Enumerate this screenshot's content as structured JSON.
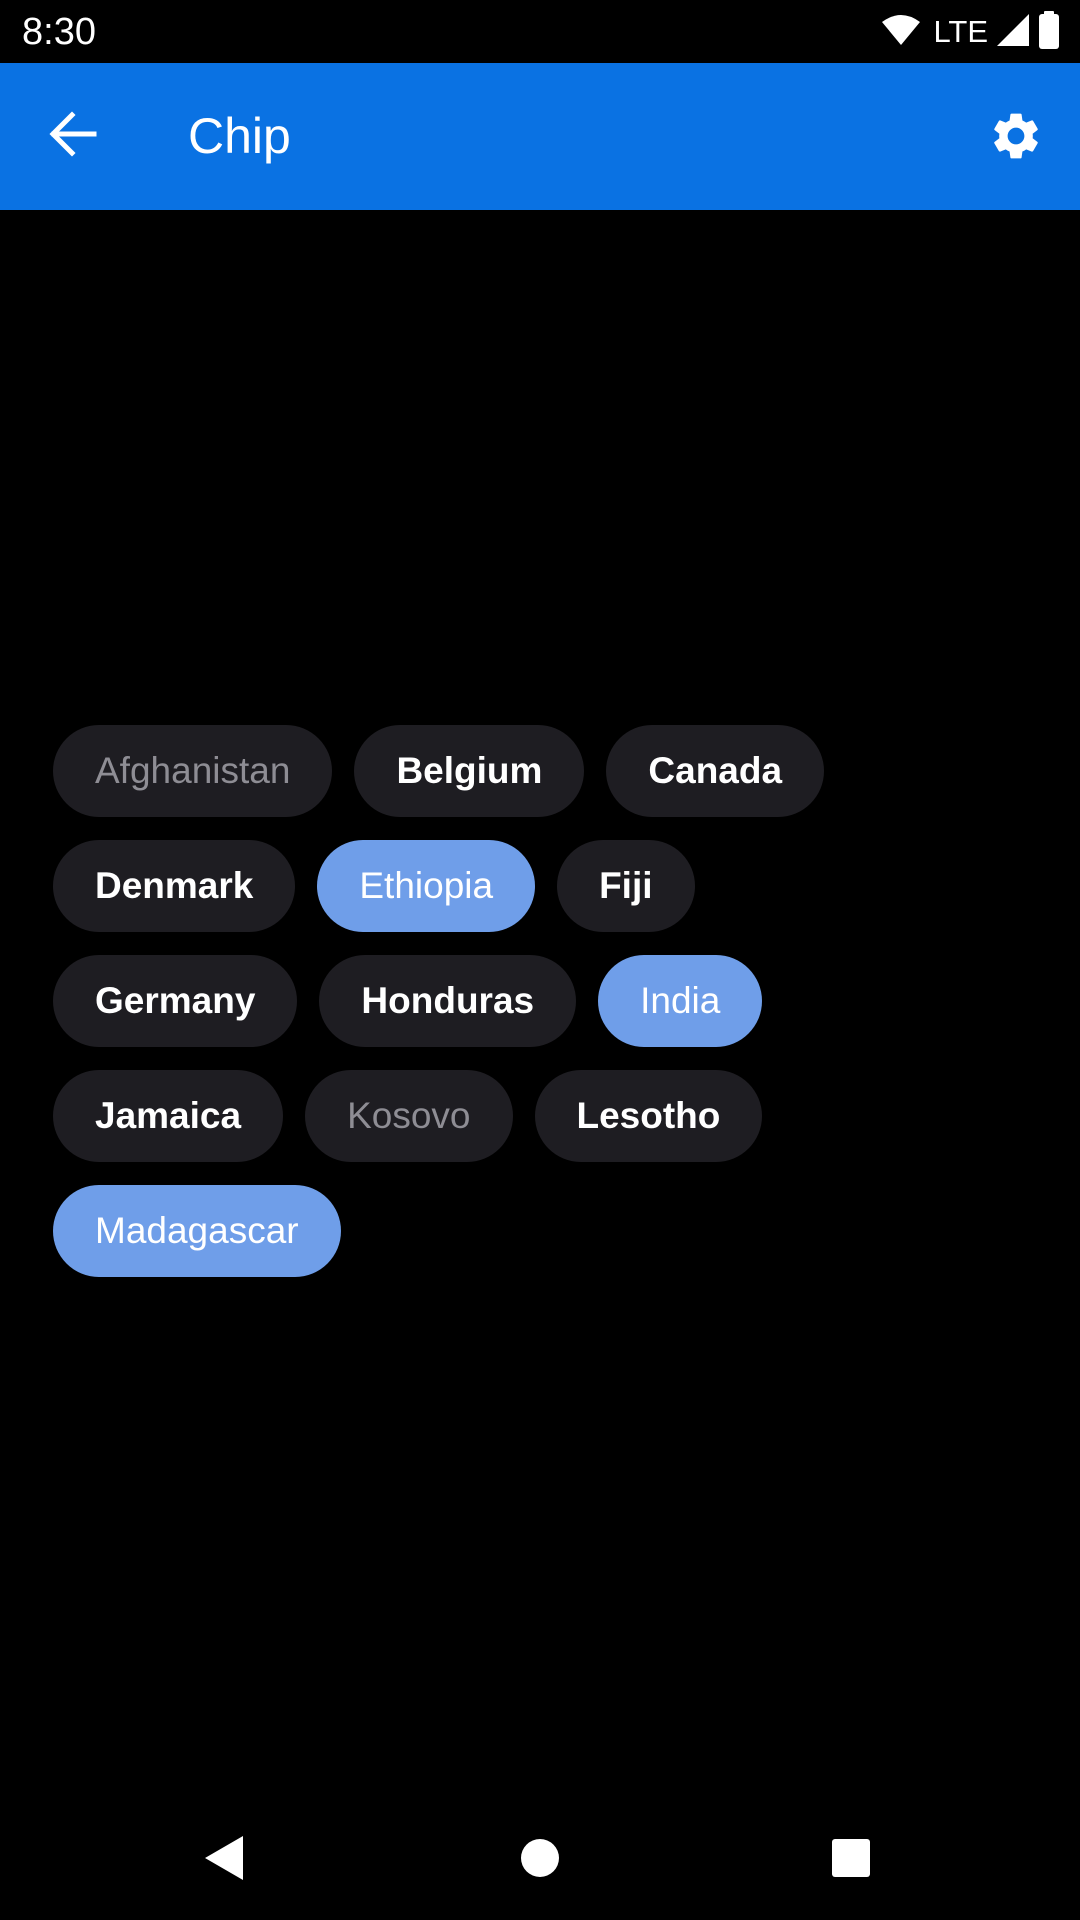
{
  "status_bar": {
    "time": "8:30",
    "network": "LTE",
    "icons": [
      "wifi-icon",
      "signal-icon",
      "battery-icon"
    ]
  },
  "app_bar": {
    "title": "Chip",
    "back_icon": "arrow-back-icon",
    "settings_icon": "gear-icon",
    "background": "#0a72e3"
  },
  "chips": {
    "rows": [
      [
        {
          "label": "Afghanistan",
          "state": "disabled"
        },
        {
          "label": "Belgium",
          "state": "default"
        },
        {
          "label": "Canada",
          "state": "default"
        }
      ],
      [
        {
          "label": "Denmark",
          "state": "default"
        },
        {
          "label": "Ethiopia",
          "state": "selected"
        },
        {
          "label": "Fiji",
          "state": "default"
        }
      ],
      [
        {
          "label": "Germany",
          "state": "default"
        },
        {
          "label": "Honduras",
          "state": "default"
        },
        {
          "label": "India",
          "state": "selected"
        }
      ],
      [
        {
          "label": "Jamaica",
          "state": "default"
        },
        {
          "label": "Kosovo",
          "state": "disabled"
        },
        {
          "label": "Lesotho",
          "state": "default"
        }
      ],
      [
        {
          "label": "Madagascar",
          "state": "selected"
        }
      ]
    ],
    "colors": {
      "default_bg": "#1e1d22",
      "selected_bg": "#6f9ee9",
      "disabled_text": "#8e8d94"
    }
  },
  "nav_bar": {
    "icons": [
      "back-triangle-icon",
      "home-circle-icon",
      "recents-square-icon"
    ]
  }
}
